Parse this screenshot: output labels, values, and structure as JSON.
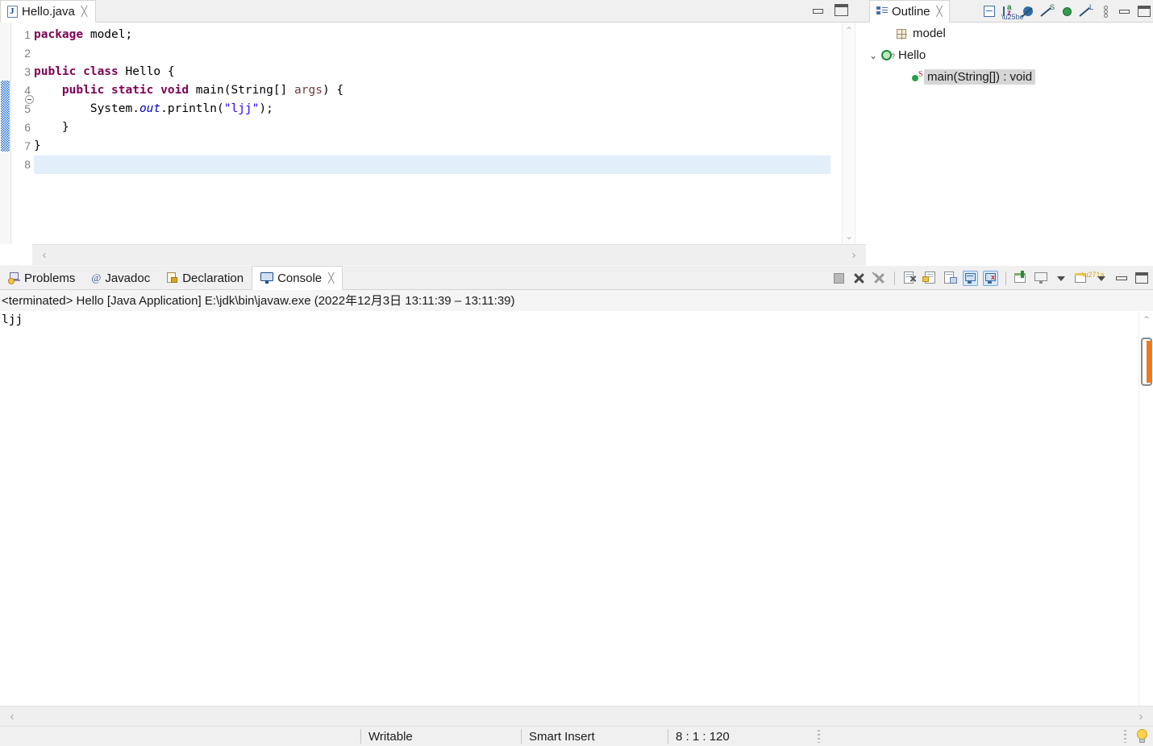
{
  "editor": {
    "tab": {
      "label": "Hello.java",
      "icon": "java-file-icon",
      "close": "╳"
    },
    "lines": [
      {
        "no": "1",
        "segments": [
          {
            "t": "package ",
            "c": "kw"
          },
          {
            "t": "model;",
            "c": ""
          }
        ]
      },
      {
        "no": "2",
        "segments": [
          {
            "t": "",
            "c": ""
          }
        ]
      },
      {
        "no": "3",
        "segments": [
          {
            "t": "public class ",
            "c": "kw"
          },
          {
            "t": "Hello {",
            "c": ""
          }
        ]
      },
      {
        "no": "4",
        "segments": [
          {
            "t": "    ",
            "c": ""
          },
          {
            "t": "public static void ",
            "c": "kw"
          },
          {
            "t": "main(String[] ",
            "c": ""
          },
          {
            "t": "args",
            "c": "prm"
          },
          {
            "t": ") {",
            "c": ""
          }
        ]
      },
      {
        "no": "5",
        "segments": [
          {
            "t": "        System.",
            "c": ""
          },
          {
            "t": "out",
            "c": "fld"
          },
          {
            "t": ".println(",
            "c": ""
          },
          {
            "t": "\"ljj\"",
            "c": "str"
          },
          {
            "t": ");",
            "c": ""
          }
        ]
      },
      {
        "no": "6",
        "segments": [
          {
            "t": "    }",
            "c": ""
          }
        ]
      },
      {
        "no": "7",
        "segments": [
          {
            "t": "}",
            "c": ""
          }
        ]
      },
      {
        "no": "8",
        "segments": [
          {
            "t": "",
            "c": ""
          }
        ],
        "current": true
      }
    ],
    "scroll": {
      "up": "⌃",
      "down": "⌄",
      "left": "‹",
      "right": "›"
    }
  },
  "outline": {
    "tab": {
      "label": "Outline",
      "close": "╳",
      "icon": "outline-icon"
    },
    "toolbar": [
      {
        "name": "collapse-all-icon"
      },
      {
        "name": "sort-alphabetically-icon"
      },
      {
        "name": "hide-fields-icon"
      },
      {
        "name": "hide-static-icon"
      },
      {
        "name": "hide-non-public-icon"
      },
      {
        "name": "hide-local-types-icon"
      },
      {
        "name": "view-menu-icon"
      },
      {
        "name": "minimize-icon"
      },
      {
        "name": "maximize-icon"
      }
    ],
    "tree": [
      {
        "label": "model",
        "icon": "package-icon",
        "indent": 18,
        "twisty": "",
        "selected": false
      },
      {
        "label": "Hello",
        "icon": "class-icon",
        "indent": 0,
        "twisty": "⌄",
        "selected": false
      },
      {
        "label": "main(String[]) : void",
        "icon": "method-icon",
        "indent": 36,
        "twisty": "",
        "selected": true
      }
    ]
  },
  "console_view": {
    "tabs": [
      {
        "label": "Problems",
        "icon": "problems-icon",
        "active": false
      },
      {
        "label": "Javadoc",
        "icon": "javadoc-icon",
        "active": false
      },
      {
        "label": "Declaration",
        "icon": "declaration-icon",
        "active": false
      },
      {
        "label": "Console",
        "icon": "console-icon",
        "active": true,
        "close": "╳"
      }
    ],
    "toolbar": [
      {
        "name": "terminate-icon"
      },
      {
        "name": "remove-launch-icon"
      },
      {
        "name": "remove-all-terminated-icon"
      },
      {
        "name": "separator"
      },
      {
        "name": "clear-console-icon"
      },
      {
        "name": "scroll-lock-icon"
      },
      {
        "name": "word-wrap-icon"
      },
      {
        "name": "show-console-on-output-icon",
        "active": true
      },
      {
        "name": "show-console-on-error-icon",
        "active": true
      },
      {
        "name": "separator"
      },
      {
        "name": "pin-console-icon"
      },
      {
        "name": "display-selected-console-icon"
      },
      {
        "name": "display-selected-console-dropdown"
      },
      {
        "name": "open-console-icon"
      },
      {
        "name": "open-console-dropdown"
      },
      {
        "name": "minimize-icon"
      },
      {
        "name": "maximize-icon"
      }
    ],
    "header": "<terminated> Hello [Java Application] E:\\jdk\\bin\\javaw.exe  (2022年12月3日 13:11:39 – 13:11:39)",
    "output": "ljj",
    "scroll": {
      "up": "⌃",
      "down": "⌄"
    }
  },
  "bottom_scroll": {
    "left": "‹",
    "right": "›"
  },
  "statusbar": {
    "writable": "Writable",
    "insert_mode": "Smart Insert",
    "position": "8 : 1 : 120",
    "bulb_icon": "quick-fix-bulb-icon"
  },
  "colors": {
    "keyword": "#7f0055",
    "string": "#2a00ff",
    "field": "#0000c0",
    "parameter": "#6a3e3e",
    "current_line": "#e3eefb",
    "selection": "#d6d6d6",
    "accent_scroll": "#f07818",
    "marker_blue": "#1f6fd0"
  }
}
